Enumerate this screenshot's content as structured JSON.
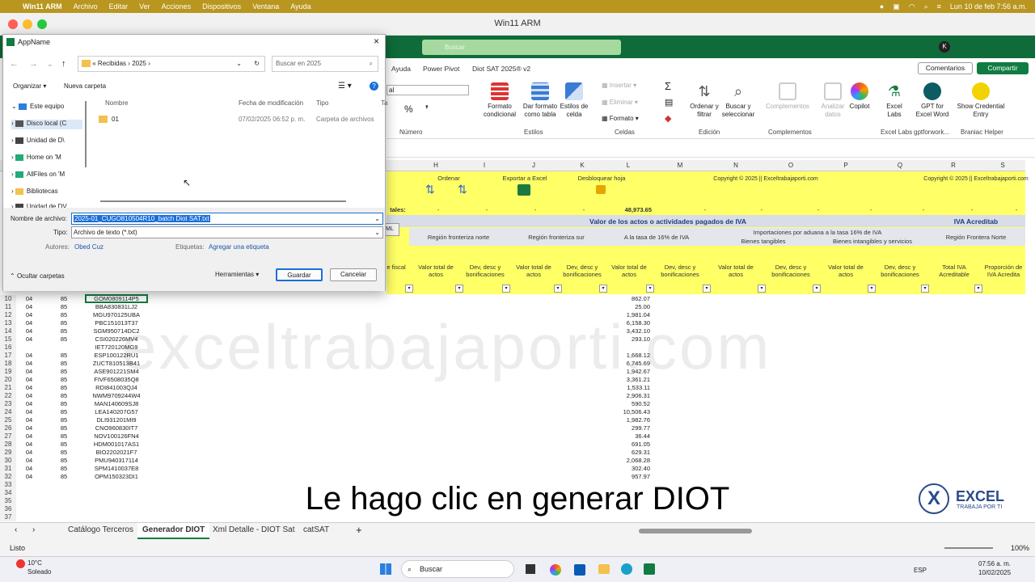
{
  "mac_menu": {
    "app": "Win11 ARM",
    "items": [
      "Archivo",
      "Editar",
      "Ver",
      "Acciones",
      "Dispositivos",
      "Ventana",
      "Ayuda"
    ],
    "clock": "Lun 10 de feb  7:56 a.m."
  },
  "window": {
    "title": "Win11 ARM"
  },
  "excel": {
    "search_placeholder": "Buscar",
    "user_initial": "K",
    "tabs": [
      "Ayuda",
      "Power Pivot",
      "Diot SAT 2025® v2"
    ],
    "comentarios": "Comentarios",
    "compartir": "Compartir",
    "font_box": "al",
    "ribbon": {
      "numero": "Número",
      "formato_condicional": "Formato condicional",
      "dar_formato": "Dar formato como tabla",
      "estilos_celda": "Estilos de celda",
      "estilos": "Estilos",
      "insertar": "Insertar",
      "eliminar": "Eliminar",
      "formato": "Formato",
      "celdas": "Celdas",
      "ordenar": "Ordenar y filtrar",
      "buscar": "Buscar y seleccionar",
      "edicion": "Edición",
      "complementos": "Complementos",
      "analizar": "Analizar datos",
      "copilot": "Copilot",
      "excel_labs": "Excel Labs",
      "gpt": "GPT for Excel Word",
      "show_cred": "Show Credential Entry",
      "g_complementos": "Complementos",
      "g_excel_labs": "Excel Labs",
      "g_gpt": "gptforwork...",
      "g_braniac": "Braniac Helper"
    },
    "columns": [
      "H",
      "I",
      "J",
      "K",
      "L",
      "M",
      "N",
      "O",
      "P",
      "Q",
      "R",
      "S"
    ],
    "header": {
      "ordenar": "Ordenar",
      "exportar": "Exportar a Excel",
      "desbloquear": "Desbloquear hoja",
      "copyright1": "Copyright © 2025 || Exceltrabajaporti.com",
      "copyright2": "Copyright © 2025 || Exceltrabajaporti.com",
      "totales": "tales:",
      "total_value": "48,973.65",
      "dash": "-",
      "ml": "ML",
      "valor_actos": "Valor de los actos o actividades pagados de IVA",
      "iva_acreditable": "IVA Acreditab",
      "region_norte": "Región fronteriza norte",
      "region_sur": "Región fronteriza sur",
      "tasa16": "A la tasa de 16% de IVA",
      "importaciones": "Importaciones por aduana a la tasa 16% de IVA",
      "bienes_tangibles": "Bienes tangibles",
      "bienes_intangibles": "Bienes intangibles y servicios",
      "region_frontera_norte": "Región Frontera Norte",
      "fiscal": "e fiscal",
      "valor_total": "Valor total de actos",
      "dev_desc": "Dev, desc y bonificaciones",
      "total_iva": "Total IVA Acreditable",
      "proporcion": "Proporción de IVA Acredita"
    },
    "rows": [
      {
        "n": "10",
        "a": "04",
        "b": "85",
        "rfc": "GOM0809114P5",
        "v": "862.07"
      },
      {
        "n": "11",
        "a": "04",
        "b": "85",
        "rfc": "BBA830831LJ2",
        "v": "25.00"
      },
      {
        "n": "12",
        "a": "04",
        "b": "85",
        "rfc": "MGU970125UBA",
        "v": "1,981.04"
      },
      {
        "n": "13",
        "a": "04",
        "b": "85",
        "rfc": "PBC151013T37",
        "v": "6,158.30"
      },
      {
        "n": "14",
        "a": "04",
        "b": "85",
        "rfc": "SGM950714DC2",
        "v": "3,432.10"
      },
      {
        "n": "15",
        "a": "04",
        "b": "85",
        "rfc": "CSI020226MV4",
        "v": "293.10"
      },
      {
        "n": "16",
        "a": "",
        "b": "",
        "rfc": "IET720120MG9",
        "v": ""
      },
      {
        "n": "17",
        "a": "04",
        "b": "85",
        "rfc": "ESP100122RU1",
        "v": "1,668.12"
      },
      {
        "n": "18",
        "a": "04",
        "b": "85",
        "rfc": "ZUCT810513B41",
        "v": "6,745.69"
      },
      {
        "n": "19",
        "a": "04",
        "b": "85",
        "rfc": "ASE901221SM4",
        "v": "1,942.67"
      },
      {
        "n": "20",
        "a": "04",
        "b": "85",
        "rfc": "FIVF6508035Q8",
        "v": "3,361.21"
      },
      {
        "n": "21",
        "a": "04",
        "b": "85",
        "rfc": "RDI841003QJ4",
        "v": "1,533.11"
      },
      {
        "n": "22",
        "a": "04",
        "b": "85",
        "rfc": "NWM9709244W4",
        "v": "2,906.31"
      },
      {
        "n": "23",
        "a": "04",
        "b": "85",
        "rfc": "MAN140609SJ8",
        "v": "590.52"
      },
      {
        "n": "24",
        "a": "04",
        "b": "85",
        "rfc": "LEA140207G57",
        "v": "10,506.43"
      },
      {
        "n": "25",
        "a": "04",
        "b": "85",
        "rfc": "DLI931201MI9",
        "v": "1,982.76"
      },
      {
        "n": "26",
        "a": "04",
        "b": "85",
        "rfc": "CNO960830IT7",
        "v": "299.77"
      },
      {
        "n": "27",
        "a": "04",
        "b": "85",
        "rfc": "NOV100126FN4",
        "v": "36.44"
      },
      {
        "n": "28",
        "a": "04",
        "b": "85",
        "rfc": "HDM001017AS1",
        "v": "691.05"
      },
      {
        "n": "29",
        "a": "04",
        "b": "85",
        "rfc": "BIO2202021F7",
        "v": "629.31"
      },
      {
        "n": "30",
        "a": "04",
        "b": "85",
        "rfc": "PMU940317114",
        "v": "2,068.28"
      },
      {
        "n": "31",
        "a": "04",
        "b": "85",
        "rfc": "SPM1410037E8",
        "v": "302.40"
      },
      {
        "n": "32",
        "a": "04",
        "b": "85",
        "rfc": "OPM150323DI1",
        "v": "957.97"
      },
      {
        "n": "33",
        "a": "",
        "b": "",
        "rfc": "",
        "v": ""
      },
      {
        "n": "34",
        "a": "",
        "b": "",
        "rfc": "",
        "v": ""
      },
      {
        "n": "35",
        "a": "",
        "b": "",
        "rfc": "",
        "v": ""
      },
      {
        "n": "36",
        "a": "",
        "b": "",
        "rfc": "",
        "v": ""
      },
      {
        "n": "37",
        "a": "",
        "b": "",
        "rfc": "",
        "v": ""
      }
    ],
    "watermark": "exceltrabajaporti.com",
    "sheet_tabs": [
      "Catálogo Terceros",
      "Generador DIOT",
      "Xml Detalle - DIOT Sat",
      "catSAT"
    ],
    "status_ready": "Listo",
    "zoom": "100%"
  },
  "subtitle": "Le hago clic en generar DIOT",
  "logo": {
    "title": "EXCEL",
    "tag": "TRABAJA POR TI"
  },
  "dialog": {
    "title": "AppName",
    "path": [
      "«",
      "Recibidas",
      "›",
      "2025",
      "›"
    ],
    "search_placeholder": "Buscar en 2025",
    "organizar": "Organizar",
    "nueva_carpeta": "Nueva carpeta",
    "nav": [
      "Este equipo",
      "Disco local (C",
      "Unidad de D\\",
      "Home on 'M",
      "AllFiles on 'M",
      "Bibliotecas",
      "Unidad de DV"
    ],
    "col_nombre": "Nombre",
    "col_fecha": "Fecha de modificación",
    "col_tipo": "Tipo",
    "col_ta": "Ta",
    "file": {
      "name": "01",
      "date": "07/02/2025 06:52 p. m.",
      "type": "Carpeta de archivos"
    },
    "label_nombre": "Nombre de archivo:",
    "filename": "2025-01_CUGO810504R10_batch Diot SAT.txt",
    "label_tipo": "Tipo:",
    "tipo_value": "Archivo de texto (*.txt)",
    "label_autores": "Autores:",
    "autor": "Obed Cuz",
    "label_etiquetas": "Etiquetas:",
    "etiqueta": "Agregar una etiqueta",
    "ocultar": "Ocultar carpetas",
    "herramientas": "Herramientas",
    "guardar": "Guardar",
    "cancelar": "Cancelar"
  },
  "taskbar": {
    "weather_temp": "10°C",
    "weather_desc": "Soleado",
    "search": "Buscar",
    "lang": "ESP",
    "time": "07:56 a. m.",
    "date": "10/02/2025"
  }
}
